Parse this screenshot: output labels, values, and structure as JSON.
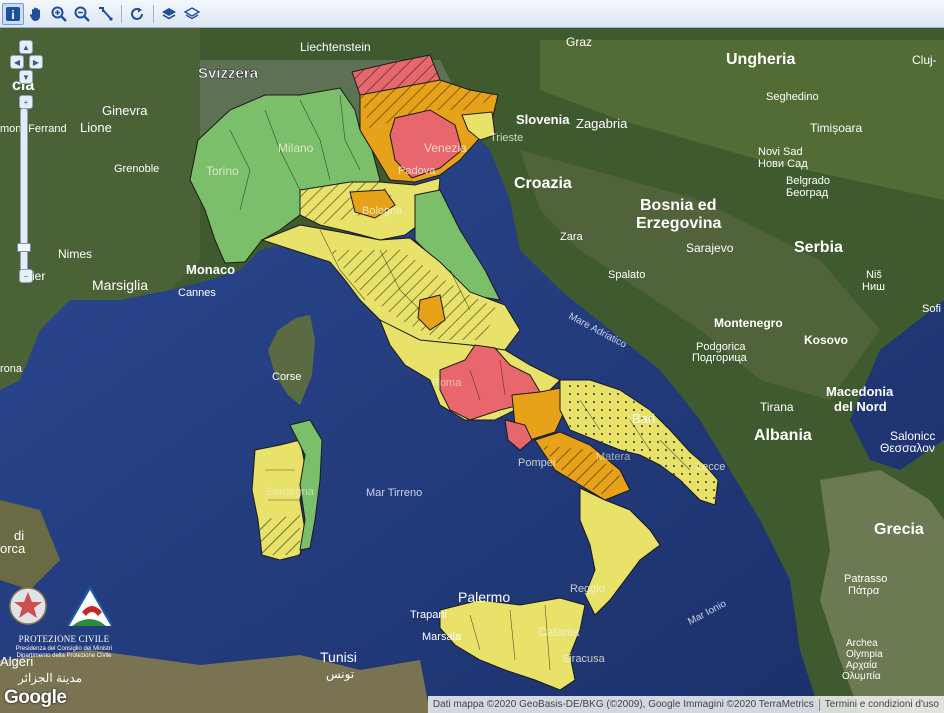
{
  "toolbar": {
    "tools": [
      {
        "name": "info-icon",
        "active": true
      },
      {
        "name": "pan-hand-icon"
      },
      {
        "name": "zoom-in-icon"
      },
      {
        "name": "zoom-out-icon"
      },
      {
        "name": "measure-icon"
      },
      {
        "name": "refresh-icon"
      },
      {
        "name": "layers-icon"
      },
      {
        "name": "layers-outline-icon"
      }
    ]
  },
  "legend_colors": {
    "green": "#7bbf6a",
    "yellow": "#e8e26a",
    "orange": "#e7a21a",
    "red": "#e8676d"
  },
  "labels": {
    "svizzera": "Svizzera",
    "liechtenstein": "Liechtenstein",
    "graz": "Graz",
    "ungheria": "Ungheria",
    "cluj": "Cluj-",
    "seghedino": "Seghedino",
    "slovenia": "Slovenia",
    "zagabria": "Zagabria",
    "timisoara": "Timișoara",
    "ginevra": "Ginevra",
    "lione": "Lione",
    "montferrand": "mont-Ferrand",
    "grenoble": "Grenoble",
    "torino": "Torino",
    "milano": "Milano",
    "venezia": "Venezia",
    "padova": "Padova",
    "trieste": "Trieste",
    "croazia": "Croazia",
    "novi_sad": "Novi Sad",
    "novi_sad_cyr": "Нови Сад",
    "belgrado": "Belgrado",
    "belgrado_cyr": "Београд",
    "bosnia1": "Bosnia ed",
    "bosnia2": "Erzegovina",
    "bologna": "Bologna",
    "zara": "Zara",
    "sarajevo": "Sarajevo",
    "serbia": "Serbia",
    "nimes": "Nimes",
    "monaco": "Monaco",
    "marsiglia": "Marsiglia",
    "cannes": "Cannes",
    "spalato": "Spalato",
    "nis": "Niš",
    "nis_cyr": "Ниш",
    "mare_adriatico": "Mare Adriatico",
    "montenegro": "Montenegro",
    "podgorica": "Podgorica",
    "podgorica_cyr": "Подгорица",
    "kosovo": "Kosovo",
    "sofia": "Sofi",
    "corse": "Corse",
    "roma": "Roma",
    "macedonia1": "Macedonia",
    "macedonia2": "del Nord",
    "bari": "Bari",
    "tirana": "Tirana",
    "albania": "Albania",
    "salonicco": "Salonicc",
    "salonicco_gr": "Θεσσαλον",
    "pompei": "Pompei",
    "lecce": "Lecce",
    "matera": "Matera",
    "sardegna": "Sardegna",
    "mar_tirreno": "Mar Tirreno",
    "grecia": "Grecia",
    "patrasso": "Patrasso",
    "patrasso_gr": "Πάτρα",
    "mar_ionio": "Mar Ionio",
    "palermo": "Palermo",
    "trapani": "Trapani",
    "marsala": "Marsala",
    "catania": "Catania",
    "siracusa": "Siracusa",
    "reggio": "Reggio",
    "tunisi": "Tunisi",
    "tunisi_ar": "تونس",
    "algeri": "Algeri",
    "algeri_ar": "مدينة الجزائر",
    "archea1": "Archea",
    "archea2": "Olympia",
    "archea3": "Αρχαία",
    "archea4": "Ολυμπία",
    "spagna_left": "cia",
    "orca_left": "orca",
    "di_left": "di",
    "rona_left": "rona",
    "ier_left": "ier"
  },
  "logo": {
    "title": "PROTEZIONE CIVILE",
    "subtitle1": "Presidenza del Consiglio dei Ministri",
    "subtitle2": "Dipartimento della Protezione Civile"
  },
  "google": "Google",
  "attribution": {
    "text": "Dati mappa ©2020 GeoBasis-DE/BKG (©2009), Google Immagini ©2020 TerraMetrics",
    "terms": "Termini e condizioni d'uso"
  }
}
